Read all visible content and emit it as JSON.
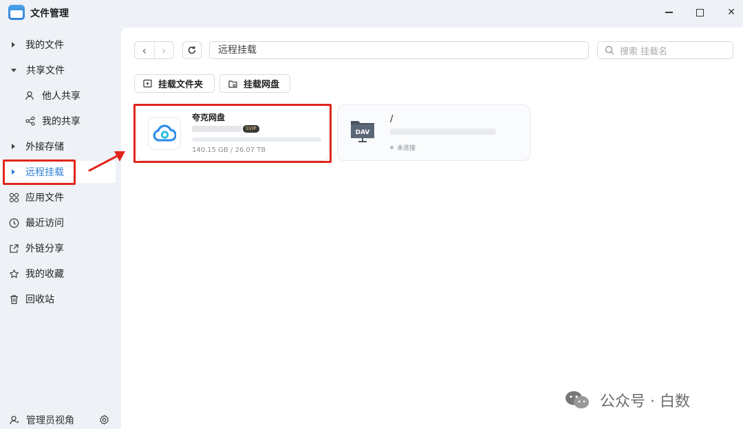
{
  "app": {
    "title": "文件管理"
  },
  "window_controls": {
    "minimize_icon": "minimize-icon",
    "maximize_icon": "maximize-icon",
    "close_icon": "close-icon",
    "close_glyph": "✕"
  },
  "sidebar": {
    "items": [
      {
        "label": "我的文件",
        "kind": "caret-right"
      },
      {
        "label": "共享文件",
        "kind": "caret-down"
      },
      {
        "label": "他人共享",
        "kind": "sub",
        "icon": "user-share-icon"
      },
      {
        "label": "我的共享",
        "kind": "sub",
        "icon": "share-icon"
      },
      {
        "label": "外接存储",
        "kind": "caret-right"
      },
      {
        "label": "远程挂载",
        "kind": "caret-right",
        "active": true
      },
      {
        "label": "应用文件",
        "icon": "apps-grid-icon"
      },
      {
        "label": "最近访问",
        "icon": "clock-icon"
      },
      {
        "label": "外链分享",
        "icon": "external-share-icon"
      },
      {
        "label": "我的收藏",
        "icon": "star-icon"
      },
      {
        "label": "回收站",
        "icon": "trash-icon"
      }
    ],
    "admin_label": "管理员视角"
  },
  "toolbar": {
    "back_glyph": "‹",
    "forward_glyph": "›",
    "path": "远程挂载",
    "search_placeholder": "搜索 挂载名",
    "mount_folder_label": "挂载文件夹",
    "mount_disk_label": "挂载网盘"
  },
  "mounts": [
    {
      "name": "夸克网盘",
      "badge": "SVIP",
      "storage": "140.15 GB / 26.07 TB",
      "icon": "quark-cloud-icon"
    },
    {
      "name": "/",
      "status": "未连接",
      "icon": "dav-folder-icon",
      "icon_text": "DAV"
    }
  ],
  "watermark": {
    "text": "公众号 · 白数"
  },
  "colors": {
    "accent": "#2f7fd6",
    "highlight_red": "#e1251b"
  }
}
